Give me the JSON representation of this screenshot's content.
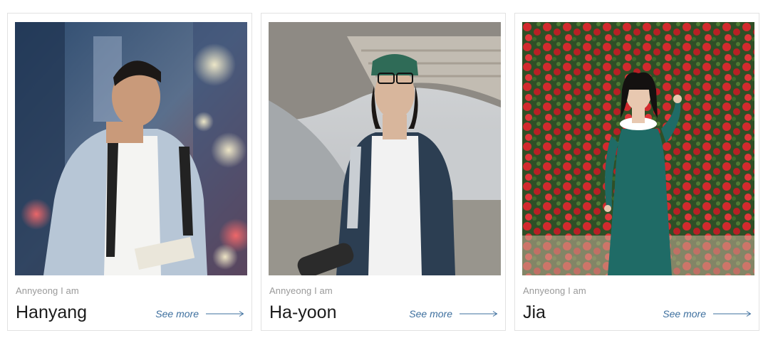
{
  "cards": [
    {
      "subtitle": "Annyeong I am",
      "name": "Hanyang",
      "link_label": "See more",
      "icon": "arrow-right-icon"
    },
    {
      "subtitle": "Annyeong I am",
      "name": "Ha-yoon",
      "link_label": "See more",
      "icon": "arrow-right-icon"
    },
    {
      "subtitle": "Annyeong I am",
      "name": "Jia",
      "link_label": "See more",
      "icon": "arrow-right-icon"
    }
  ],
  "colors": {
    "link": "#3d6f9e",
    "card_border": "#e2e2e2",
    "subtitle": "#9a9a9a",
    "name": "#1b1b1b"
  }
}
